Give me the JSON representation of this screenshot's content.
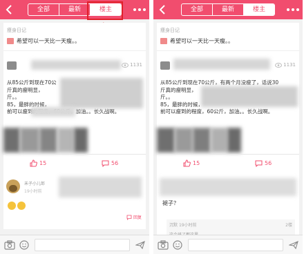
{
  "tabs": [
    "全部",
    "最新",
    "楼主"
  ],
  "left_active_tab": 2,
  "right_active_tab": 2,
  "post": {
    "category": "痩身日记",
    "title": "希望可以一天比一天瘦。。",
    "view_count": "1131",
    "body_lines_left": [
      "从85公斤到现在70公",
      "斤真的瘦明显，",
      "斤。。",
      "85，最胖的时候，",
      "前可以瘦到的程度，60公斤，加油。。长久战啊。"
    ],
    "body_lines_right": [
      "从85公斤到现在70公斤，有两个月没瘦了，话说30",
      "斤真的瘦明显，",
      "斤。。",
      "85，最胖的时候，",
      "前可以瘦到的程度，60公斤，加油。。长久战啊。"
    ],
    "like_count": "15",
    "comment_count": "56"
  },
  "left_comment": {
    "name": "禾子小儿郎",
    "time": "19小时前",
    "reply_label": "回复"
  },
  "right_comment": {
    "text": "褪子？",
    "sub_name": "沉默",
    "sub_time": "19小时前",
    "sub_floor": "2楼",
    "sub_text": "这个班了都这里"
  },
  "colors": {
    "accent": "#f14d6e",
    "highlight": "#e0202a"
  },
  "icons": [
    "back-icon",
    "more-icon",
    "eye-icon",
    "like-icon",
    "comment-icon",
    "reply-icon",
    "camera-icon",
    "emoji-icon",
    "send-icon"
  ]
}
